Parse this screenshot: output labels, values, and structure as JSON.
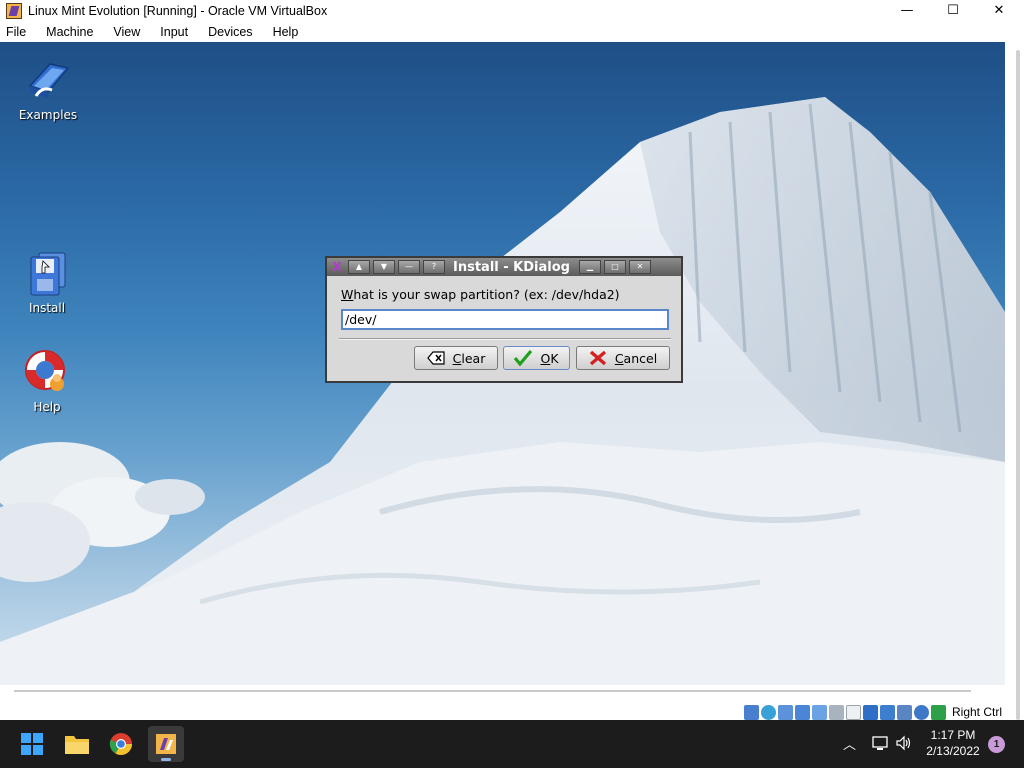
{
  "window": {
    "title": "Linux Mint Evolution [Running] - Oracle VM VirtualBox",
    "controls": {
      "minimize": "—",
      "maximize": "☐",
      "close": "✕"
    }
  },
  "menubar": {
    "items": [
      "File",
      "Machine",
      "View",
      "Input",
      "Devices",
      "Help"
    ]
  },
  "desktop": {
    "icons": [
      {
        "label": "Examples",
        "icon": "examples-icon"
      },
      {
        "label": "Install",
        "icon": "install-icon"
      },
      {
        "label": "Help",
        "icon": "help-lifebuoy-icon"
      }
    ]
  },
  "dialog": {
    "title": "Install - KDialog",
    "prompt_first_letter": "W",
    "prompt_rest": "hat is your swap partition? (ex: /dev/hda2)",
    "input_value": "/dev/",
    "buttons": {
      "clear_first": "C",
      "clear_rest": "lear",
      "ok_first": "O",
      "ok_rest": "K",
      "cancel_first": "C",
      "cancel_rest": "ancel"
    },
    "titlebar_buttons": [
      "▲",
      "▼",
      "—",
      "?",
      "▁",
      "□",
      "✕"
    ]
  },
  "statusbar": {
    "host_key": "Right Ctrl",
    "icons": [
      "hard-disk-icon",
      "optical-drive-icon",
      "audio-icon",
      "network-icon",
      "usb-icon",
      "shared-folders-icon",
      "display-icon",
      "video-capture-icon",
      "recording-icon",
      "cpu-icon",
      "mouse-integration-icon",
      "keyboard-capture-icon"
    ]
  },
  "taskbar": {
    "apps": [
      "start-icon",
      "file-explorer-icon",
      "chrome-icon",
      "virtualbox-icon"
    ],
    "clock_time": "1:17 PM",
    "clock_date": "2/13/2022",
    "notification_count": "1"
  }
}
